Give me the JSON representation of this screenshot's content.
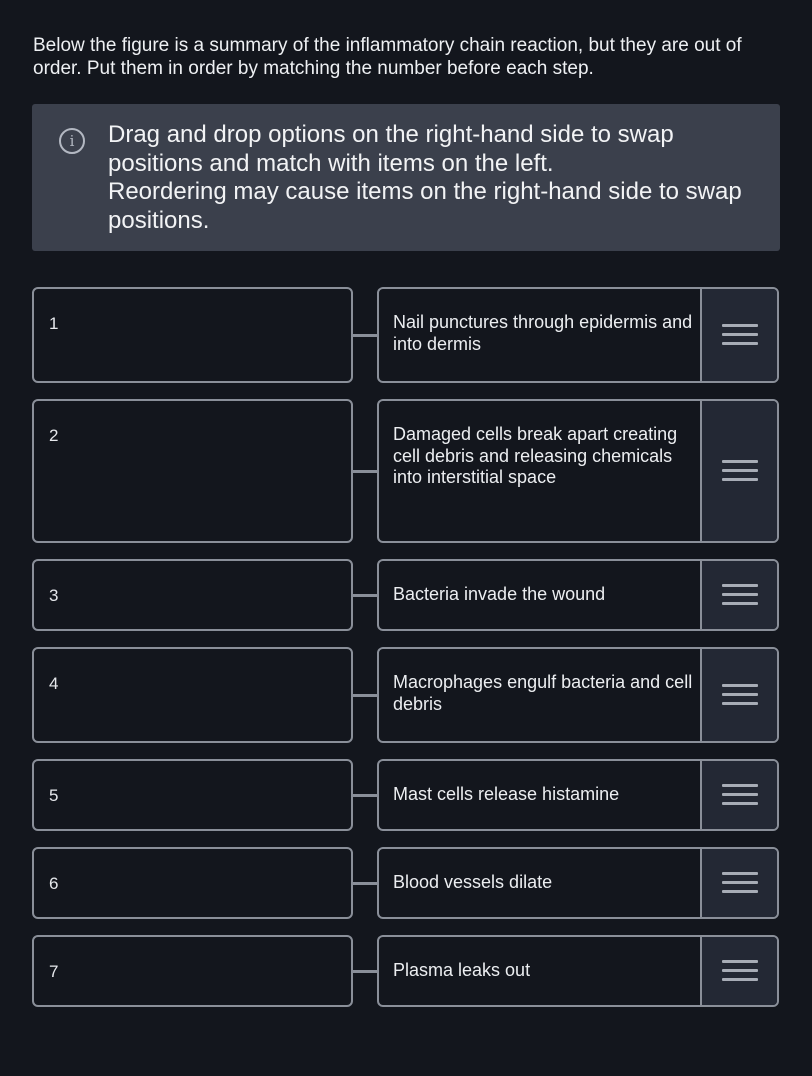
{
  "prompt": "Below the figure is a summary of the inflammatory chain reaction, but they are out of order. Put them in order by matching the number before each step.",
  "info": {
    "icon": "info-icon",
    "line1": "Drag and drop options on the right-hand side to swap positions and match with items on the left.",
    "line2": "Reordering may cause items on the right-hand side to swap positions."
  },
  "rows": [
    {
      "number": "1",
      "option": "Nail punctures through epidermis and into dermis"
    },
    {
      "number": "2",
      "option": "Damaged cells break apart creating cell debris and releasing chemicals into interstitial space"
    },
    {
      "number": "3",
      "option": "Bacteria invade the wound"
    },
    {
      "number": "4",
      "option": "Macrophages engulf bacteria and cell debris"
    },
    {
      "number": "5",
      "option": "Mast cells release histamine"
    },
    {
      "number": "6",
      "option": "Blood vessels dilate"
    },
    {
      "number": "7",
      "option": "Plasma leaks out"
    }
  ],
  "handle_icon": "drag-handle-icon"
}
